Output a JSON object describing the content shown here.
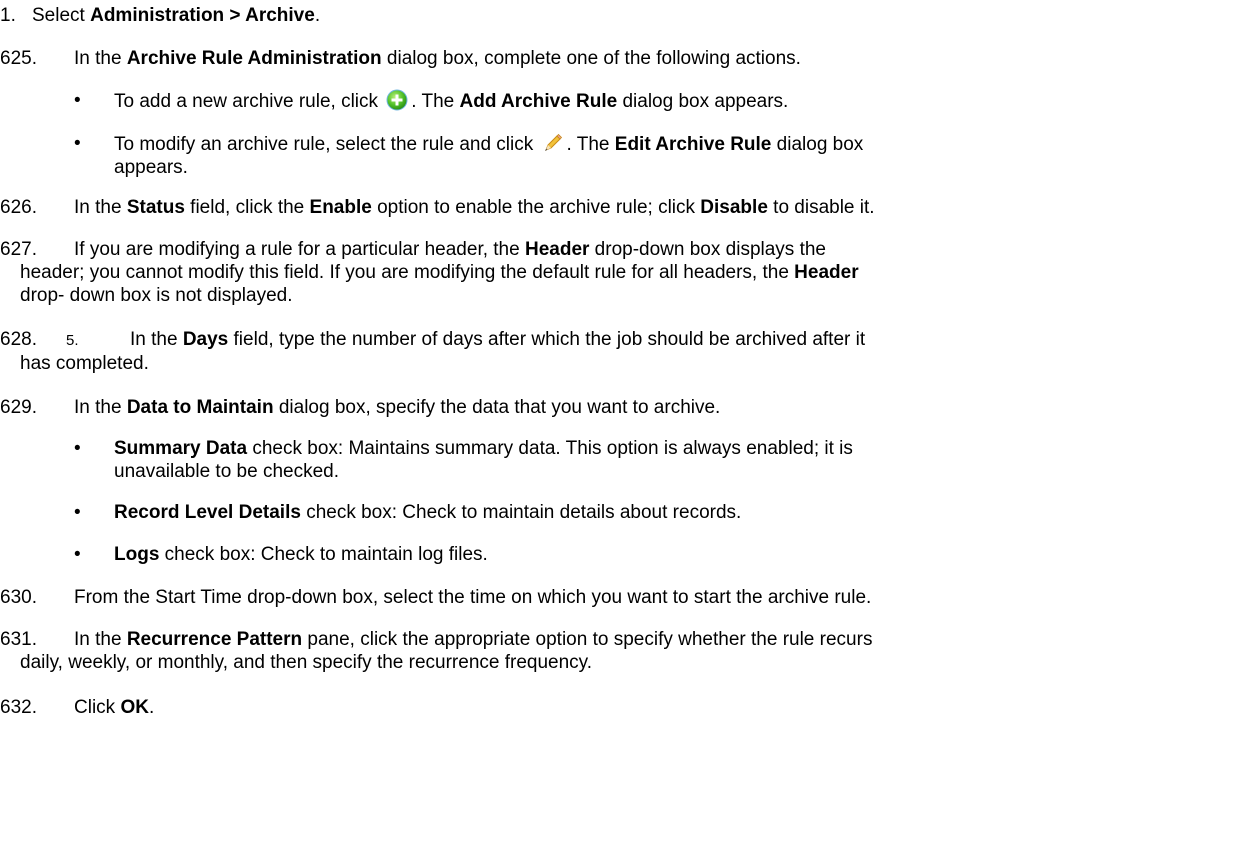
{
  "steps": [
    {
      "num": "1.",
      "parts": [
        "Select ",
        "Administration > Archive",
        "."
      ]
    },
    {
      "num": "625.",
      "parts": [
        "In the ",
        "Archive Rule Administration",
        " dialog box, complete one of the following actions."
      ],
      "bullets": [
        {
          "parts": [
            "To add a new archive rule, click ",
            ". The ",
            "Add Archive Rule",
            " dialog box appears."
          ],
          "icon": "add-green-circle-icon"
        },
        {
          "parts": [
            "To modify an archive rule, select the rule and click ",
            ". The ",
            "Edit Archive Rule",
            " dialog box",
            "appears."
          ],
          "icon": "pencil-edit-icon"
        }
      ]
    },
    {
      "num": "626.",
      "parts": [
        "In the ",
        "Status",
        " field, click the ",
        "Enable",
        " option to enable the archive rule; click ",
        "Disable",
        " to disable it."
      ]
    },
    {
      "num": "627.",
      "parts": [
        "If you are modifying a rule for a particular header, the ",
        "Header",
        " drop-down box displays the",
        "header;  you cannot modify this field. If you are modifying the default rule for all headers, the ",
        "Header",
        "drop-   down box is not displayed."
      ]
    },
    {
      "num": "628.",
      "sub": "5.",
      "parts": [
        "In the ",
        "Days",
        " field, type the number of days after which the job should be archived after it",
        "has  completed."
      ]
    },
    {
      "num": "629.",
      "parts": [
        "In the ",
        "Data to Maintain",
        " dialog box, specify the data that you want to archive."
      ],
      "bullets": [
        {
          "parts": [
            "Summary Data",
            " check box: Maintains summary data. This option is always enabled; it is",
            "unavailable to be checked."
          ]
        },
        {
          "parts": [
            "Record Level Details",
            " check box: Check to maintain details about records."
          ]
        },
        {
          "parts": [
            "Logs",
            " check box: Check to maintain log files."
          ]
        }
      ]
    },
    {
      "num": "630.",
      "parts": [
        "From the Start Time drop-down box, select the time on which you want to start the archive rule."
      ]
    },
    {
      "num": "631.",
      "parts": [
        "In the ",
        "Recurrence Pattern",
        " pane, click the appropriate option to specify whether the rule recurs",
        "daily,  weekly, or monthly, and then specify the recurrence frequency."
      ]
    },
    {
      "num": "632.",
      "parts": [
        "Click ",
        "OK",
        "."
      ]
    }
  ],
  "bullet_glyph": "•"
}
